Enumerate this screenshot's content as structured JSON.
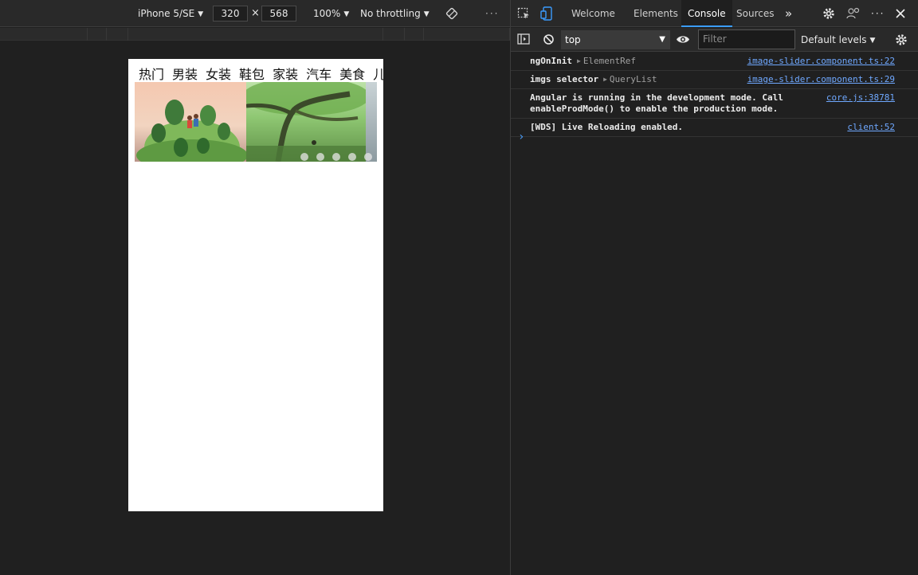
{
  "device_toolbar": {
    "device_name": "iPhone 5/SE",
    "width": "320",
    "times": "×",
    "height": "568",
    "zoom": "100%",
    "throttling": "No throttling",
    "rotate_icon": "rotate-icon",
    "more_icon": "more-dots-icon"
  },
  "page": {
    "menu_items": [
      "热门",
      "男装",
      "女装",
      "鞋包",
      "家装",
      "汽车",
      "美食",
      "儿"
    ],
    "slider": {
      "slide_count": 5
    }
  },
  "devtools": {
    "tabs": [
      {
        "label": "Welcome"
      },
      {
        "label": "Elements"
      },
      {
        "label": "Console"
      },
      {
        "label": "Sources"
      }
    ],
    "active_tab": "Console",
    "icons": {
      "inspect": "inspect-icon",
      "device_toggle": "device-toggle-icon",
      "overflow": "chevron-double-right-icon",
      "settings": "gear-icon",
      "customize": "people-icon",
      "more": "more-dots-icon",
      "close": "close-icon"
    },
    "console_toolbar": {
      "context": "top",
      "filter_placeholder": "Filter",
      "levels": "Default levels"
    },
    "messages": [
      {
        "text": "ngOnInit",
        "detail": "ElementRef",
        "source": "image-slider.component.ts:22"
      },
      {
        "text": "imgs selector",
        "detail": "QueryList",
        "source": "image-slider.component.ts:29"
      },
      {
        "text": "Angular is running in the development mode. Call enableProdMode() to enable the production mode.",
        "detail": "",
        "source": "core.js:38781"
      },
      {
        "text": "[WDS] Live Reloading enabled.",
        "detail": "",
        "source": "client:52"
      }
    ],
    "prompt": "›"
  },
  "colors": {
    "accent": "#3b9cff",
    "link": "#6fa8ff",
    "panel": "#202020",
    "toolbar": "#292929"
  }
}
